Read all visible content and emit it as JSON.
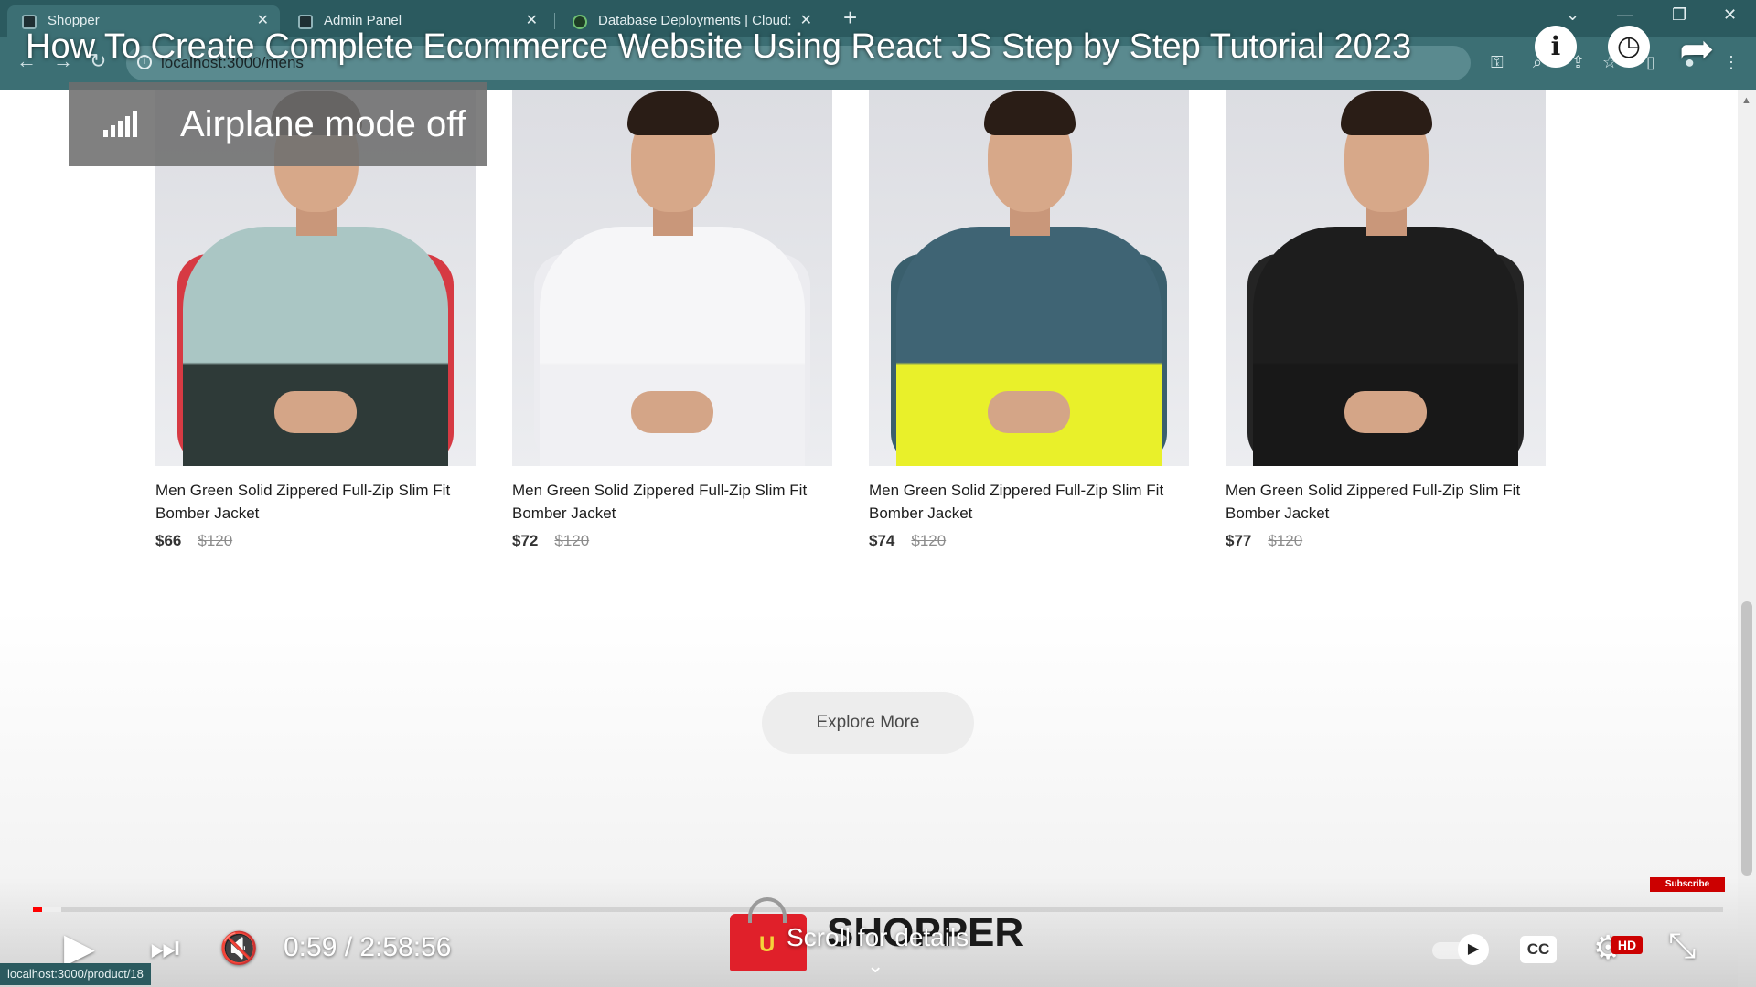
{
  "browser": {
    "tabs": [
      {
        "label": "Shopper",
        "active": true
      },
      {
        "label": "Admin Panel",
        "active": false
      },
      {
        "label": "Database Deployments | Cloud: ",
        "active": false
      }
    ],
    "url": "localhost:3000/mens",
    "status_url": "localhost:3000/product/18"
  },
  "video": {
    "title": "How To Create Complete Ecommerce Website Using React JS Step by Step Tutorial 2023",
    "time_current": "0:59",
    "time_total": "2:58:56",
    "time_display": "0:59 / 2:58:56",
    "played_fraction": 0.0055,
    "buffered_fraction": 0.017,
    "toast": "Airplane mode off",
    "scroll_hint": "Scroll for details",
    "subscribe_label": "Subscribe",
    "hd_label": "HD",
    "cc_label": "CC",
    "brand_color": "#ff0000"
  },
  "products": [
    {
      "name": "Men Green Solid Zippered Full-Zip Slim Fit Bomber Jacket",
      "new_price": "$66",
      "old_price": "$120",
      "jacket": "colorblock",
      "colors": {
        "main": "#aac6c4",
        "sleeve": "#d63a43",
        "lower": "#2e3a38"
      }
    },
    {
      "name": "Men Green Solid Zippered Full-Zip Slim Fit Bomber Jacket",
      "new_price": "$72",
      "old_price": "$120",
      "jacket": "white-hoodie",
      "colors": {
        "main": "#f6f6f8",
        "sleeve": "#ececf0",
        "lower": "#f0f0f3"
      }
    },
    {
      "name": "Men Green Solid Zippered Full-Zip Slim Fit Bomber Jacket",
      "new_price": "$74",
      "old_price": "$120",
      "jacket": "denim-yellow-hoodie",
      "colors": {
        "main": "#3f6474",
        "sleeve": "#3a5f6d",
        "lower": "#e9f02a"
      }
    },
    {
      "name": "Men Green Solid Zippered Full-Zip Slim Fit Bomber Jacket",
      "new_price": "$77",
      "old_price": "$120",
      "jacket": "black-leather",
      "colors": {
        "main": "#1d1d1d",
        "sleeve": "#242424",
        "lower": "#181818"
      }
    }
  ],
  "explore_label": "Explore More",
  "logo": {
    "text": "SHOPPER",
    "bag_letter": "U"
  }
}
